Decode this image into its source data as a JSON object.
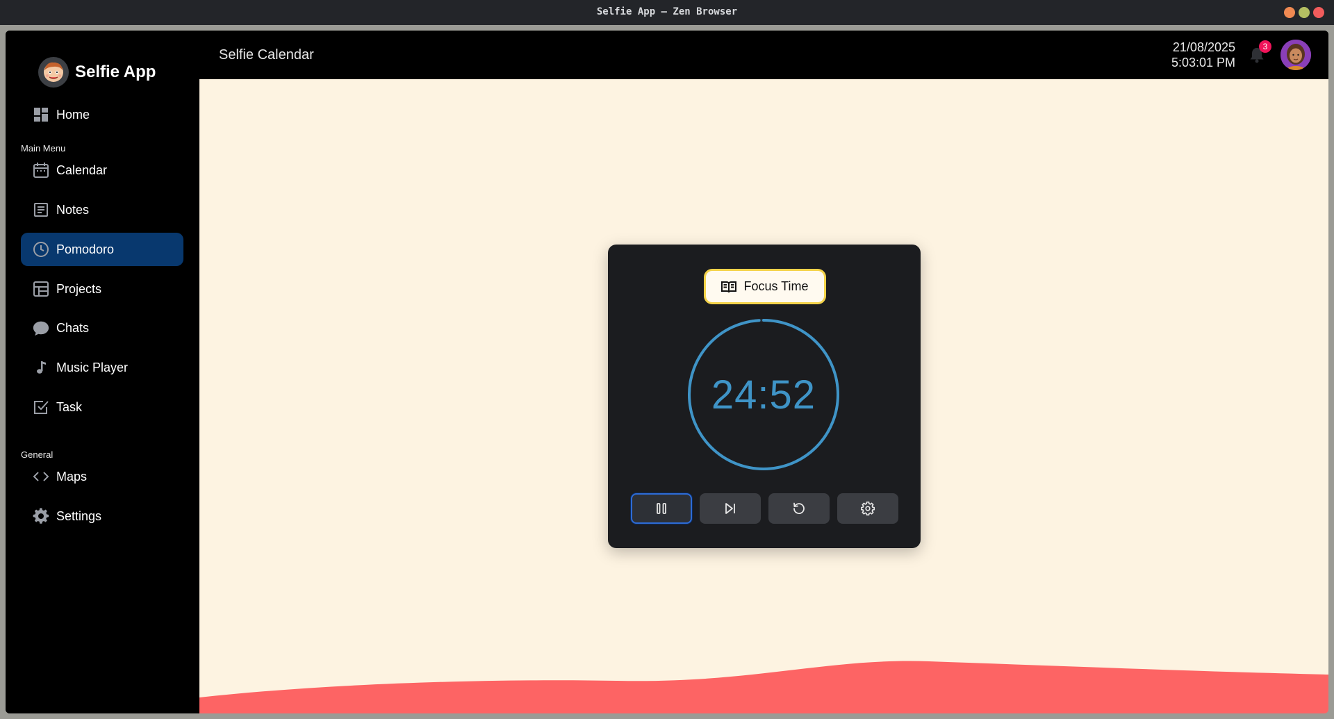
{
  "window": {
    "title": "Selfie App — Zen Browser"
  },
  "app": {
    "name": "Selfie App"
  },
  "sidebar": {
    "home": {
      "label": "Home",
      "icon": "dashboard-icon"
    },
    "sections": [
      {
        "label": "Main Menu"
      },
      {
        "label": "General"
      }
    ],
    "items": [
      {
        "label": "Calendar",
        "icon": "calendar-icon"
      },
      {
        "label": "Notes",
        "icon": "notes-icon"
      },
      {
        "label": "Pomodoro",
        "icon": "clock-icon",
        "active": true
      },
      {
        "label": "Projects",
        "icon": "table-icon"
      },
      {
        "label": "Chats",
        "icon": "chat-bubble-icon"
      },
      {
        "label": "Music Player",
        "icon": "music-note-icon"
      },
      {
        "label": "Task",
        "icon": "checkbox-icon"
      },
      {
        "label": "Maps",
        "icon": "code-brackets-icon"
      },
      {
        "label": "Settings",
        "icon": "gear-icon"
      }
    ]
  },
  "header": {
    "title": "Selfie Calendar",
    "date": "21/08/2025",
    "time": "5:03:01 PM",
    "notification_count": "3"
  },
  "pomodoro": {
    "mode_label": "Focus Time",
    "time_remaining": "24:52",
    "progress_fraction": 0.99,
    "controls": [
      {
        "name": "pause",
        "icon": "pause-icon"
      },
      {
        "name": "skip",
        "icon": "skip-next-icon"
      },
      {
        "name": "reset",
        "icon": "reset-icon"
      },
      {
        "name": "settings",
        "icon": "gear-icon"
      }
    ]
  },
  "colors": {
    "accent_active": "#08386e",
    "timer": "#3f94c7",
    "mode_border": "#f4d34a",
    "main_bg": "#fdf3e1",
    "wave": "#fd6464",
    "badge": "#f0145a"
  }
}
